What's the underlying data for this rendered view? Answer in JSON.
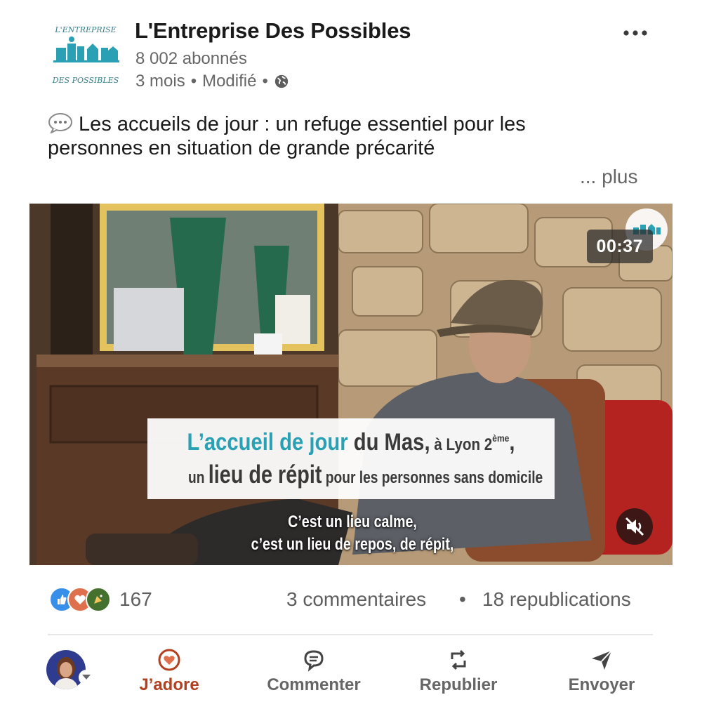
{
  "post": {
    "author": {
      "name": "L'Entreprise Des Possibles",
      "followers": "8 002 abonnés",
      "age": "3 mois",
      "edited": "Modifié",
      "separator": "•",
      "logo_icon": "entreprise-des-possibles-logo"
    },
    "more_icon": "more-horizontal-icon",
    "text": "Les accueils de jour : un refuge essentiel pour les personnes en situation de grande précarité",
    "see_more": "... plus",
    "video": {
      "duration": "00:37",
      "caption": {
        "l1_highlight": "L’accueil de jour",
        "l1_mid": " du Mas,",
        "l1_small": " à Lyon 2",
        "l1_sup": "ème",
        "l1_end": ",",
        "l2_pre": "un ",
        "l2_big": "lieu de répit",
        "l2_post": " pour les personnes sans domicile"
      },
      "subtitle_l1": "C’est un lieu calme,",
      "subtitle_l2": "c’est un lieu de repos, de répit,",
      "mute_icon": "speaker-muted-icon"
    },
    "social": {
      "reactions_count": "167",
      "comments": "3 commentaires",
      "dot": "•",
      "reposts": "18 republications"
    },
    "actions": {
      "like": "J’adore",
      "comment": "Commenter",
      "repost": "Republier",
      "send": "Envoyer"
    }
  },
  "colors": {
    "accent_love": "#b24020",
    "muted_text": "#666666",
    "logo_teal": "#2aa0b4"
  }
}
